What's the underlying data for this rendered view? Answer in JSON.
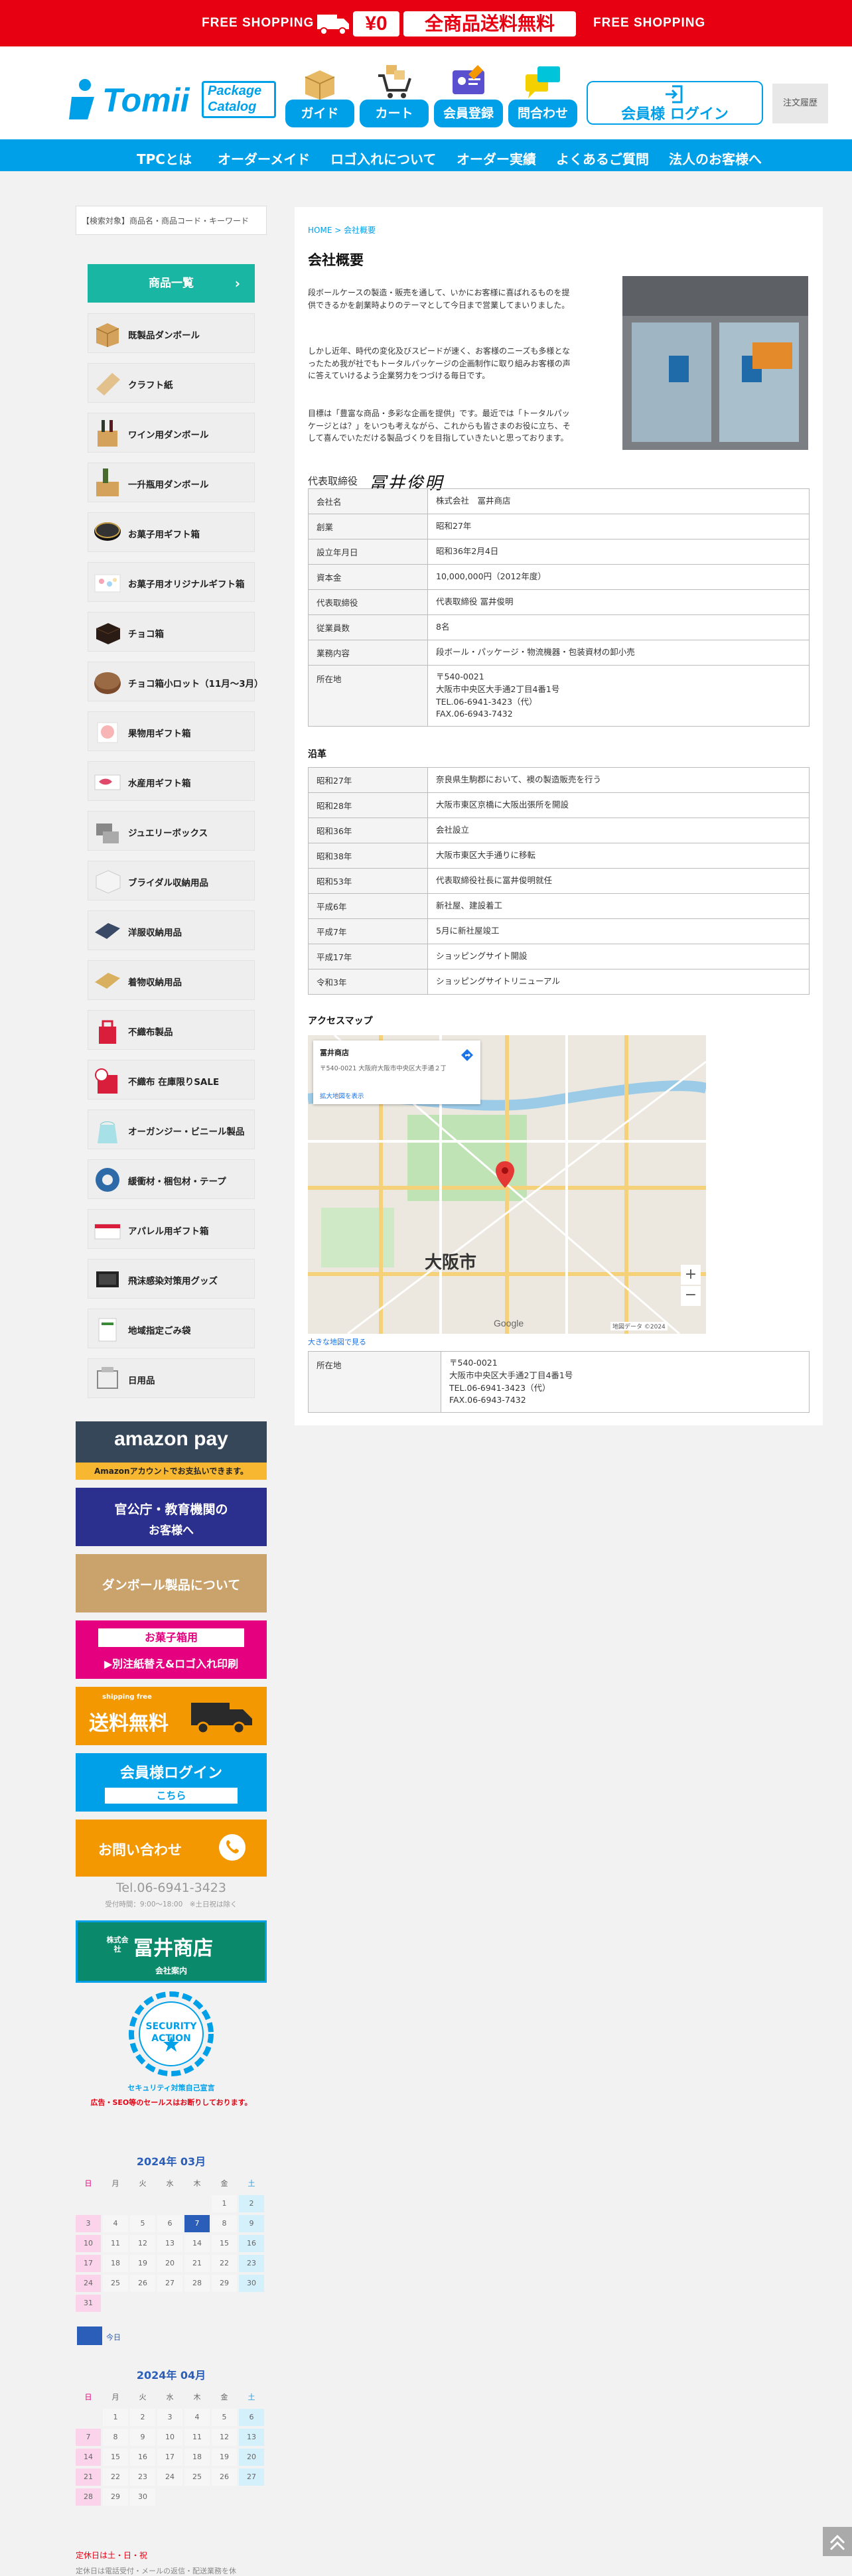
{
  "top_banner": {
    "left_text": "FREE SHOPPING",
    "yen_text": "¥0",
    "main_text": "全商品送料無料",
    "right_text": "FREE SHOPPING"
  },
  "header": {
    "logo_main": "Tomii",
    "logo_sub1": "Package",
    "logo_sub2": "Catalog",
    "buttons": [
      {
        "label": "ガイド"
      },
      {
        "label": "カート"
      },
      {
        "label": "会員登録"
      },
      {
        "label": "問合わせ"
      }
    ],
    "login_label": "会員様 ログイン",
    "history_label": "注文履歴"
  },
  "nav": {
    "items": [
      "TPCとは",
      "オーダーメイド",
      "ロゴ入れについて",
      "オーダー実績",
      "よくあるご質問",
      "法人のお客様へ"
    ]
  },
  "sidebar": {
    "search_placeholder": "【検索対象】商品名・商品コード・キーワード",
    "category_header": "商品一覧",
    "categories": [
      "既製品ダンボール",
      "クラフト紙",
      "ワイン用ダンボール",
      "一升瓶用ダンボール",
      "お菓子用ギフト箱",
      "お菓子用オリジナルギフト箱",
      "チョコ箱",
      "チョコ箱小ロット（11月～3月）",
      "果物用ギフト箱",
      "水産用ギフト箱",
      "ジュエリーボックス",
      "ブライダル収納用品",
      "洋服収納用品",
      "着物収納用品",
      "不織布製品",
      "不織布 在庫限りSALE",
      "オーガンジー・ビニール製品",
      "緩衝材・梱包材・テープ",
      "アパレル用ギフト箱",
      "飛沫感染対策用グッズ",
      "地域指定ごみ袋",
      "日用品"
    ],
    "banners": {
      "amazon_main": "amazon pay",
      "amazon_sub": "Amazonアカウントでお支払いできます。",
      "govt_line1": "官公庁・教育機関の",
      "govt_line2": "お客様へ",
      "cardboard": "ダンボール製品について",
      "candy_top": "お菓子箱用",
      "candy_bottom": "▶別注紙替え&ロゴ入れ印刷",
      "shipping_small": "shipping free",
      "shipping": "送料無料",
      "login_line1": "会員様ログイン",
      "login_line2": "こちら",
      "contact": "お問い合わせ",
      "tel": "Tel.06-6941-3423",
      "hours": "受付時間：9:00～18:00　※土日祝は除く",
      "company_line1": "株式会社",
      "company_line2": "冨井商店",
      "company_sub": "会社案内",
      "security_line1": "SECURITY",
      "security_line2": "ACTION",
      "security_caption": "セキュリティ対策自己宣言",
      "notice": "広告・SEO等のセールスはお断りしております。"
    },
    "calendar1": {
      "title": "2024年 03月",
      "weekdays": [
        "日",
        "月",
        "火",
        "水",
        "木",
        "金",
        "土"
      ],
      "weeks": [
        [
          "",
          "",
          "",
          "",
          "",
          "1",
          "2"
        ],
        [
          "3",
          "4",
          "5",
          "6",
          "7",
          "8",
          "9"
        ],
        [
          "10",
          "11",
          "12",
          "13",
          "14",
          "15",
          "16"
        ],
        [
          "17",
          "18",
          "19",
          "20",
          "21",
          "22",
          "23"
        ],
        [
          "24",
          "25",
          "26",
          "27",
          "28",
          "29",
          "30"
        ],
        [
          "31",
          "",
          "",
          "",
          "",
          "",
          ""
        ]
      ],
      "today": "7",
      "today_label": "今日"
    },
    "calendar2": {
      "title": "2024年 04月",
      "weekdays": [
        "日",
        "月",
        "火",
        "水",
        "木",
        "金",
        "土"
      ],
      "weeks": [
        [
          "",
          "1",
          "2",
          "3",
          "4",
          "5",
          "6"
        ],
        [
          "7",
          "8",
          "9",
          "10",
          "11",
          "12",
          "13"
        ],
        [
          "14",
          "15",
          "16",
          "17",
          "18",
          "19",
          "20"
        ],
        [
          "21",
          "22",
          "23",
          "24",
          "25",
          "26",
          "27"
        ],
        [
          "28",
          "29",
          "30",
          "",
          "",
          "",
          ""
        ]
      ]
    },
    "holiday_note": "定休日は土・日・祝",
    "holiday_sub": "定休日は電話受付・メールの返信・配送業務を休"
  },
  "content": {
    "breadcrumb": "HOME > 会社概要",
    "title": "会社概要",
    "para1": "段ボールケースの製造・販売を通して、いかにお客様に喜ばれるものを提供できるかを創業時よりのテーマとして今日まで営業してまいりました。",
    "para2": "しかし近年、時代の変化及びスピードが速く、お客様のニーズも多様となったため我が社でもトータルパッケージの企画制作に取り組みお客様の声に答えていけるよう企業努力をつづける毎日です。",
    "para3": "目標は「豊富な商品・多彩な企画を提供」です。最近では「トータルパッケージとは？」をいつも考えながら、これからも皆さまのお役に立ち、そして喜んでいただける製品づくりを目指していきたいと思っております。",
    "rep_label": "代表取締役",
    "rep_signature": "冨井俊明",
    "company_table": [
      {
        "k": "会社名",
        "v": "株式会社　冨井商店"
      },
      {
        "k": "創業",
        "v": "昭和27年"
      },
      {
        "k": "設立年月日",
        "v": "昭和36年2月4日"
      },
      {
        "k": "資本金",
        "v": "10,000,000円（2012年度）"
      },
      {
        "k": "代表取締役",
        "v": "代表取締役 冨井俊明"
      },
      {
        "k": "従業員数",
        "v": "8名"
      },
      {
        "k": "業務内容",
        "v": "段ボール・パッケージ・物流機器・包装資材の卸小売"
      },
      {
        "k": "所在地",
        "v": "〒540-0021\n大阪市中央区大手通2丁目4番1号\nTEL.06-6941-3423（代）\nFAX.06-6943-7432"
      }
    ],
    "history_title": "沿革",
    "history_table": [
      {
        "k": "昭和27年",
        "v": "奈良県生駒郡において、襖の製造販売を行う"
      },
      {
        "k": "昭和28年",
        "v": "大阪市東区京橋に大阪出張所を開設"
      },
      {
        "k": "昭和36年",
        "v": "会社設立"
      },
      {
        "k": "昭和38年",
        "v": "大阪市東区大手通りに移転"
      },
      {
        "k": "昭和53年",
        "v": "代表取締役社長に冨井俊明就任"
      },
      {
        "k": "平成6年",
        "v": "新社屋、建設着工"
      },
      {
        "k": "平成7年",
        "v": "5月に新社屋竣工"
      },
      {
        "k": "平成17年",
        "v": "ショッピングサイト開設"
      },
      {
        "k": "令和3年",
        "v": "ショッピングサイトリニューアル"
      }
    ],
    "access_title": "アクセスマップ",
    "map": {
      "info_title": "冨井商店",
      "info_addr": "〒540-0021 大阪府大阪市中央区大手通２丁目",
      "info_link": "拡大地図を表示",
      "city_label": "大阪市",
      "larger_map": "大きな地図で見る",
      "google": "Google",
      "map_data": "地図データ ©2024"
    },
    "map_table": [
      {
        "k": "所在地",
        "v": "〒540-0021\n大阪市中央区大手通2丁目4番1号\nTEL.06-6941-3423（代）\nFAX.06-6943-7432"
      }
    ]
  },
  "colors": {
    "red": "#e60012",
    "blue": "#00a0e9",
    "teal": "#19b7a3",
    "orange": "#f39800",
    "pink": "#e4007f"
  }
}
